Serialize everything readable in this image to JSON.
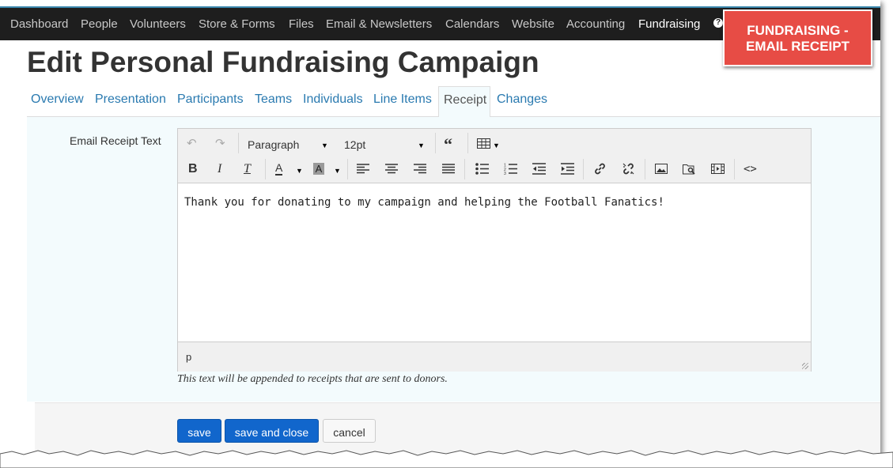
{
  "nav": {
    "items": [
      "Dashboard",
      "People",
      "Volunteers",
      "Store & Forms",
      "Files",
      "Email & Newsletters",
      "Calendars",
      "Website",
      "Accounting",
      "Fundraising"
    ],
    "active": "Fundraising",
    "help_icon": "question-circle-icon"
  },
  "callout": {
    "line1": "FUNDRAISING -",
    "line2": "EMAIL RECEIPT"
  },
  "page": {
    "title": "Edit Personal Fundraising Campaign"
  },
  "tabs": [
    "Overview",
    "Presentation",
    "Participants",
    "Teams",
    "Individuals",
    "Line Items",
    "Receipt",
    "Changes"
  ],
  "active_tab": "Receipt",
  "form": {
    "label": "Email Receipt Text",
    "editor": {
      "block_format": "Paragraph",
      "font_size": "12pt",
      "content": "Thank you for donating to my campaign and helping the Football Fanatics!",
      "path": "p"
    },
    "help_text": "This text will be appended to receipts that are sent to donors."
  },
  "buttons": {
    "save": "save",
    "save_close": "save and close",
    "cancel": "cancel"
  },
  "colors": {
    "accent": "#1166cc",
    "link": "#2a7ab0",
    "callout": "#e74c45",
    "topbar": "#1e1e1e"
  }
}
